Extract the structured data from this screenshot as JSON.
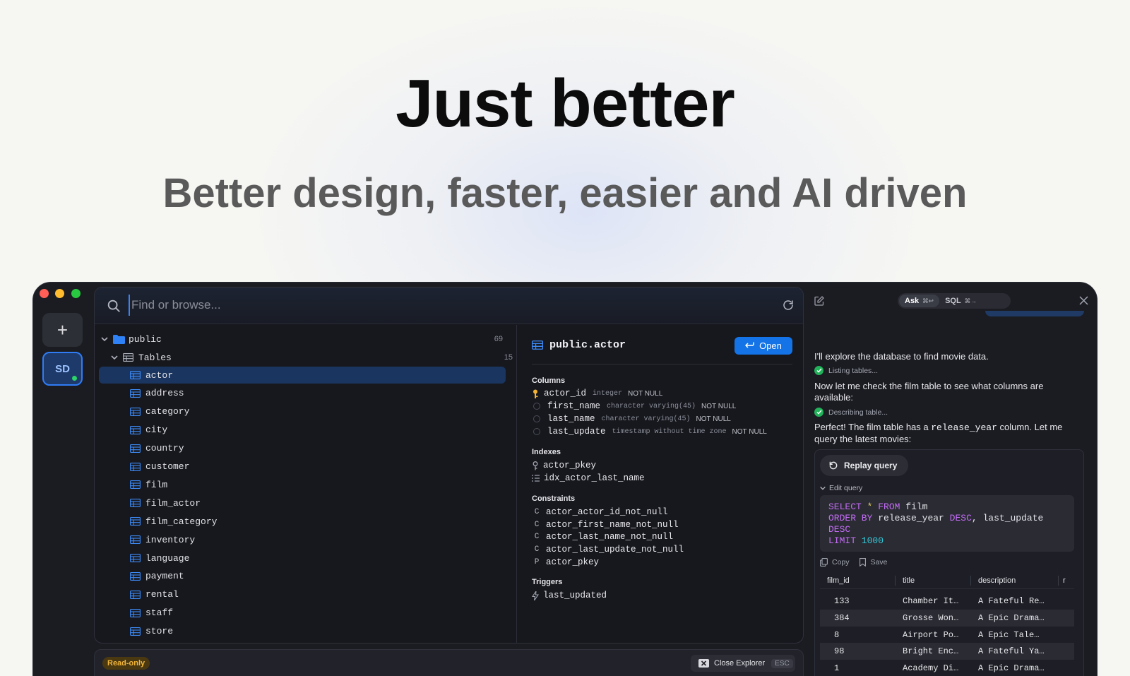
{
  "hero": {
    "title": "Just better",
    "subtitle": "Better design, faster, easier and AI driven"
  },
  "sidebar": {
    "add_label": "+",
    "connection_initials": "SD"
  },
  "explorer": {
    "search_placeholder": "Find or browse...",
    "tree": {
      "schema": "public",
      "schema_count": "69",
      "group": "Tables",
      "group_count": "15",
      "tables": [
        "actor",
        "address",
        "category",
        "city",
        "country",
        "customer",
        "film",
        "film_actor",
        "film_category",
        "inventory",
        "language",
        "payment",
        "rental",
        "staff",
        "store"
      ],
      "selected": "actor"
    },
    "detail": {
      "title": "public.actor",
      "open_label": "Open",
      "columns_heading": "Columns",
      "columns": [
        {
          "name": "actor_id",
          "type": "integer",
          "nullability": "NOT NULL",
          "key": true
        },
        {
          "name": "first_name",
          "type": "character varying(45)",
          "nullability": "NOT NULL",
          "key": false
        },
        {
          "name": "last_name",
          "type": "character varying(45)",
          "nullability": "NOT NULL",
          "key": false
        },
        {
          "name": "last_update",
          "type": "timestamp without time zone",
          "nullability": "NOT NULL",
          "key": false
        }
      ],
      "indexes_heading": "Indexes",
      "indexes": [
        "actor_pkey",
        "idx_actor_last_name"
      ],
      "constraints_heading": "Constraints",
      "constraints": [
        {
          "kind": "C",
          "name": "actor_actor_id_not_null"
        },
        {
          "kind": "C",
          "name": "actor_first_name_not_null"
        },
        {
          "kind": "C",
          "name": "actor_last_name_not_null"
        },
        {
          "kind": "C",
          "name": "actor_last_update_not_null"
        },
        {
          "kind": "P",
          "name": "actor_pkey"
        }
      ],
      "triggers_heading": "Triggers",
      "triggers": [
        "last_updated"
      ]
    },
    "footer": {
      "readonly_label": "Read-only",
      "close_label": "Close Explorer",
      "close_shortcut": "ESC"
    }
  },
  "ai_panel": {
    "modes": [
      {
        "label": "Ask",
        "shortcut": "⌘↩",
        "active": true
      },
      {
        "label": "SQL",
        "shortcut": "⌘→",
        "active": false
      }
    ],
    "message1": "I'll explore the database to find movie data.",
    "tool1": "Listing tables...",
    "message2": "Now let me check the film table to see what columns are available:",
    "tool2": "Describing table...",
    "message3_pre": "Perfect! The film table has a",
    "message3_code": "release_year",
    "message3_post": "column. Let me query the latest movies:",
    "replay_label": "Replay query",
    "edit_label": "Edit query",
    "sql": {
      "kw_select": "SELECT",
      "star": "*",
      "kw_from": "FROM",
      "table": "film",
      "kw_order": "ORDER BY",
      "order_cols": "release_year",
      "kw_desc": "DESC",
      "order_col2": "last_update",
      "kw_desc2": "DESC",
      "kw_limit": "LIMIT",
      "limit": "1000"
    },
    "copy_label": "Copy",
    "save_label": "Save",
    "result": {
      "columns": [
        "film_id",
        "title",
        "description",
        "r"
      ],
      "rows": [
        [
          "133",
          "Chamber It…",
          "A Fateful Re…"
        ],
        [
          "384",
          "Grosse Won…",
          "A Epic Drama…"
        ],
        [
          "8",
          "Airport Po…",
          "A Epic Tale…"
        ],
        [
          "98",
          "Bright Enc…",
          "A Fateful Ya…"
        ],
        [
          "1",
          "Academy Di…",
          "A Epic Drama…"
        ]
      ]
    }
  },
  "colors": {
    "accent": "#1473e6",
    "selected_row": "#1a355f",
    "success": "#22b35a",
    "readonly": "#f0b43a"
  }
}
